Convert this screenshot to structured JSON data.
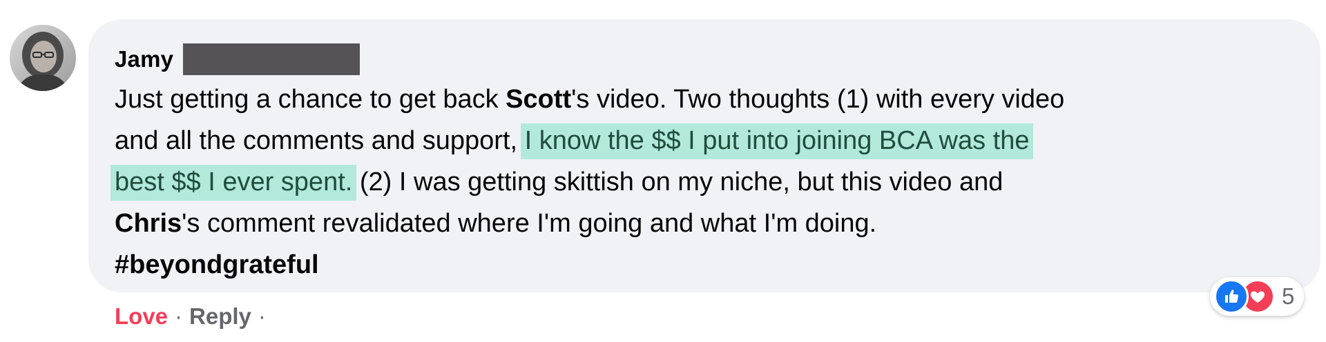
{
  "comment": {
    "author": "Jamy",
    "avatar_icon": "user-avatar-photo",
    "redaction_color": "#555355",
    "lines": [
      {
        "parts": [
          {
            "text": "Just getting a chance to get back ",
            "style": "normal"
          },
          {
            "text": "Scott",
            "style": "bold"
          },
          {
            "text": "'s video. Two thoughts (1) with every video",
            "style": "normal"
          }
        ]
      },
      {
        "parts": [
          {
            "text": "and all the comments and support, ",
            "style": "normal"
          },
          {
            "text": "I know the $$ I put into joining BCA was the",
            "style": "highlight"
          }
        ]
      },
      {
        "parts": [
          {
            "text": "best $$ I ever spent.",
            "style": "highlight"
          },
          {
            "text": " (2) I was getting skittish on my niche, but this video and",
            "style": "normal"
          }
        ]
      },
      {
        "parts": [
          {
            "text": "Chris",
            "style": "bold"
          },
          {
            "text": "'s comment revalidated where I'm going and what I'm doing.",
            "style": "normal"
          }
        ]
      },
      {
        "parts": [
          {
            "text": "#beyondgrateful",
            "style": "bold"
          }
        ]
      }
    ],
    "highlight_color": "#b3e9da"
  },
  "reactions": {
    "icons": [
      "like-icon",
      "love-icon"
    ],
    "count": "5",
    "like_color": "#1877f2",
    "love_color": "#f33e58"
  },
  "actions": {
    "love_label": "Love",
    "separator": "·",
    "reply_label": "Reply",
    "trailing_separator": "·"
  }
}
